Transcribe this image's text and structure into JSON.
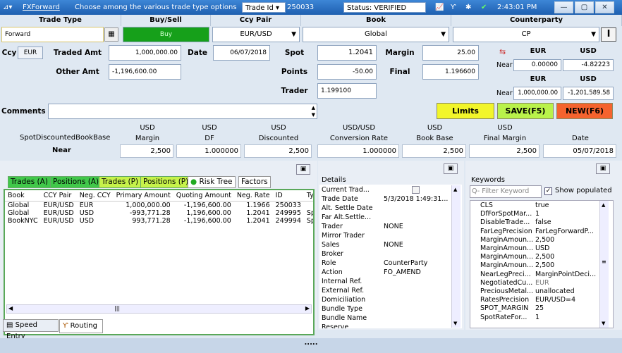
{
  "window": {
    "app_label": "FXForward",
    "hint": "Choose among the various trade type options",
    "trade_id_label": "Trade Id",
    "trade_id": "250033",
    "status": "Status: VERIFIED",
    "time": "2:43:01 PM"
  },
  "headers": {
    "trade_type": "Trade Type",
    "buy_sell": "Buy/Sell",
    "ccy_pair": "Ccy Pair",
    "book": "Book",
    "counterparty": "Counterparty"
  },
  "row1": {
    "trade_type": "Forward",
    "buy_sell": "Buy",
    "ccy_pair": "EUR/USD",
    "book": "Global",
    "counterparty": "CP"
  },
  "labels": {
    "ccy": "Ccy",
    "traded_amt": "Traded Amt",
    "date": "Date",
    "spot": "Spot",
    "margin": "Margin",
    "other_amt": "Other Amt",
    "points": "Points",
    "final": "Final",
    "trader": "Trader",
    "comments": "Comments"
  },
  "values": {
    "ccy": "EUR",
    "traded_amt": "1,000,000.00",
    "date": "06/07/2018",
    "spot": "1.2041",
    "margin": "25.00",
    "other_amt": "-1,196,600.00",
    "points": "-50.00",
    "final": "1.196600",
    "trader": "1.199100"
  },
  "near": {
    "hdr_eur": "EUR",
    "hdr_usd": "USD",
    "label": "Near",
    "val1": "0.00000",
    "val2": "-4.82223",
    "hdr2_eur": "EUR",
    "hdr2_usd": "USD",
    "label2": "Near",
    "val3": "1,000,000.00",
    "val4": "-1,201,589.58"
  },
  "buttons": {
    "limits": "Limits",
    "save": "SAVE(F5)",
    "new": "NEW(F6)"
  },
  "summary": {
    "row_label": "SpotDiscountedBookBase",
    "near_label": "Near",
    "cols": [
      {
        "ccy": "USD",
        "name": "Margin",
        "value": "2,500"
      },
      {
        "ccy": "USD",
        "name": "DF",
        "value": "1.000000"
      },
      {
        "ccy": "USD",
        "name": "Discounted",
        "value": "2,500"
      },
      {
        "ccy": "USD/USD",
        "name": "Conversion Rate",
        "value": "1.000000"
      },
      {
        "ccy": "USD",
        "name": "Book Base",
        "value": "2,500"
      },
      {
        "ccy": "USD",
        "name": "Final Margin",
        "value": "2,500"
      },
      {
        "ccy": "",
        "name": "Date",
        "value": "05/07/2018"
      }
    ]
  },
  "tabs": [
    "Trades (A)",
    "Positions (A)",
    "Trades (P)",
    "Positions (P)",
    "Risk Tree",
    "Factors"
  ],
  "trades": {
    "columns": [
      "Book",
      "CCY Pair",
      "Neg. CCY",
      "Primary Amount",
      "Quoting Amount",
      "Neg. Rate",
      "ID",
      "Ty"
    ],
    "rows": [
      [
        "Global",
        "EUR/USD",
        "EUR",
        "1,000,000.00",
        "-1,196,600.00",
        "1.1966",
        "250033",
        ""
      ],
      [
        "Global",
        "EUR/USD",
        "USD",
        "-993,771.28",
        "1,196,600.00",
        "1.2041",
        "249995",
        "Sp"
      ],
      [
        "BookNYC",
        "EUR/USD",
        "USD",
        "993,771.28",
        "-1,196,600.00",
        "1.2041",
        "249994",
        "Sp"
      ]
    ]
  },
  "bottom_tabs": {
    "speed_entry": "Speed Entry",
    "routing": "Routing"
  },
  "details": {
    "title": "Details",
    "rows": [
      [
        "Current Trad...",
        ""
      ],
      [
        "Trade Date",
        "5/3/2018 1:49:31..."
      ],
      [
        "Alt. Settle Date",
        ""
      ],
      [
        "Far Alt.Settle...",
        ""
      ],
      [
        "Trader",
        "NONE"
      ],
      [
        "Mirror Trader",
        ""
      ],
      [
        "Sales",
        "NONE"
      ],
      [
        "Broker",
        ""
      ],
      [
        "Role",
        "CounterParty"
      ],
      [
        "Action",
        "FO_AMEND"
      ],
      [
        "Internal Ref.",
        ""
      ],
      [
        "External Ref.",
        ""
      ],
      [
        "Domiciliation",
        ""
      ],
      [
        "Bundle Type",
        ""
      ],
      [
        "Bundle Name",
        ""
      ],
      [
        "Reserve",
        ""
      ]
    ]
  },
  "keywords": {
    "title": "Keywords",
    "filter_placeholder": "Filter Keyword",
    "show_populated": "Show populated",
    "rows": [
      [
        "CLS",
        "true"
      ],
      [
        "DfForSpotMar...",
        "1"
      ],
      [
        "DisableTrade...",
        "false"
      ],
      [
        "FarLegPrecision",
        "FarLegForwardP..."
      ],
      [
        "MarginAmoun...",
        "2,500"
      ],
      [
        "MarginAmoun...",
        "USD"
      ],
      [
        "MarginAmoun...",
        "2,500"
      ],
      [
        "MarginAmoun...",
        "2,500"
      ],
      [
        "NearLegPreci...",
        "MarginPointDeci..."
      ],
      [
        "NegotiatedCu...",
        "EUR"
      ],
      [
        "PreciousMetal...",
        "unallocated"
      ],
      [
        "RatesPrecision",
        "EUR/USD=4"
      ],
      [
        "SPOT_MARGIN",
        "25"
      ],
      [
        "SpotRateFor...",
        "1"
      ]
    ]
  },
  "footer": {
    "grip": "....."
  }
}
